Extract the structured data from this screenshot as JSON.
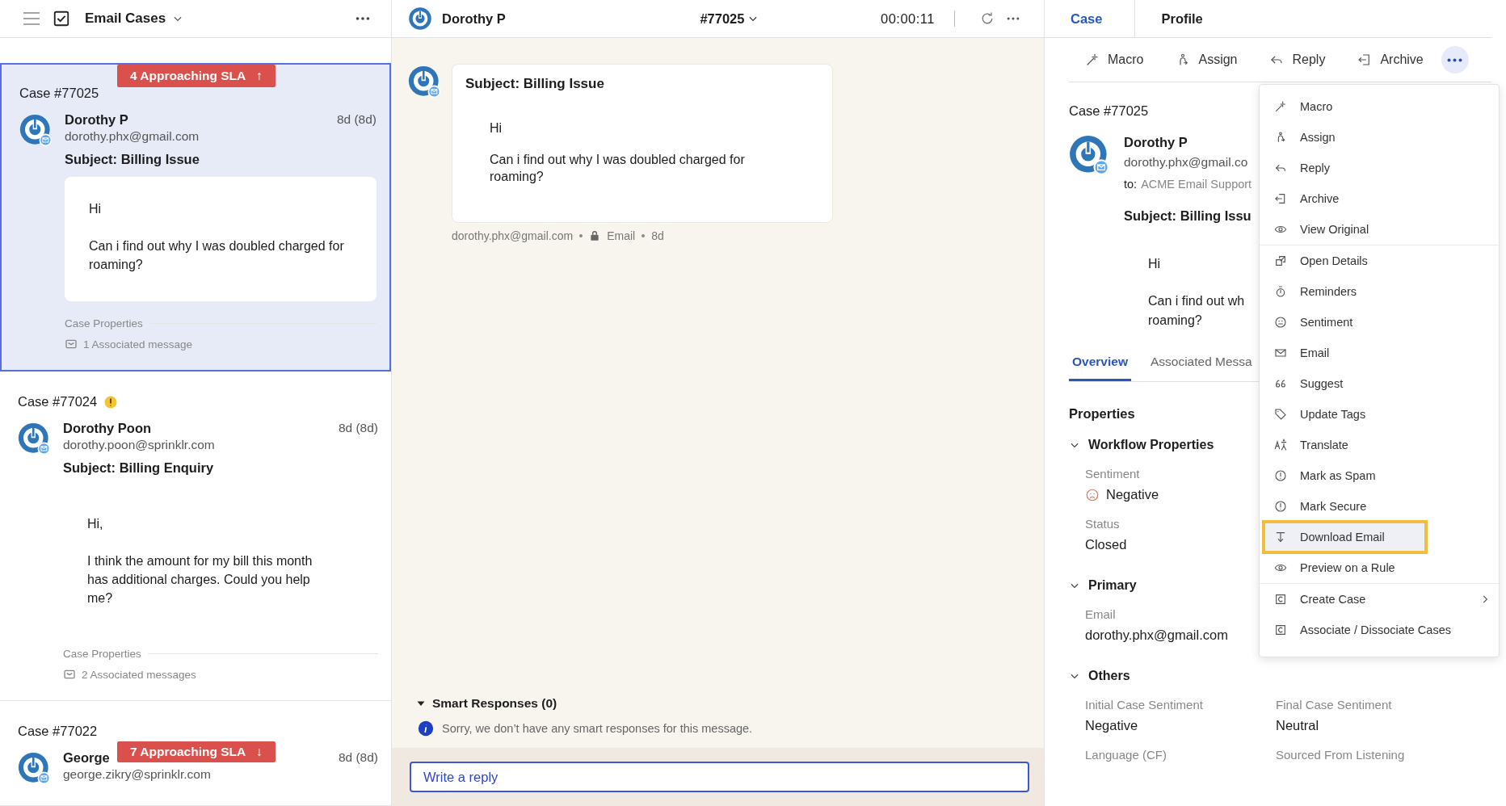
{
  "list_header": {
    "title": "Email Cases",
    "select_all_checked": true
  },
  "cases": [
    {
      "case_number": "Case #77025",
      "warning": false,
      "selected": true,
      "sla": {
        "text": "4 Approaching SLA",
        "arrow": "↑"
      },
      "name": "Dorothy P",
      "email": "dorothy.phx@gmail.com",
      "time": "8d (8d)",
      "subject": "Subject: Billing Issue",
      "boxed": true,
      "body": [
        "Hi",
        "Can i find out why I was doubled charged for roaming?"
      ],
      "properties_label": "Case Properties",
      "associated": "1 Associated message"
    },
    {
      "case_number": "Case #77024",
      "warning": true,
      "selected": false,
      "name": "Dorothy Poon",
      "email": "dorothy.poon@sprinklr.com",
      "time": "8d (8d)",
      "subject": "Subject: Billing Enquiry",
      "boxed": false,
      "body": [
        "Hi,",
        "I think the amount for my bill this month has additional charges. Could you help me?"
      ],
      "properties_label": "Case Properties",
      "associated": "2 Associated messages"
    },
    {
      "case_number": "Case #77022",
      "warning": false,
      "selected": false,
      "sla": {
        "text": "7 Approaching SLA",
        "arrow": "↓"
      },
      "name": "George",
      "email": "george.zikry@sprinklr.com",
      "time": "8d (8d)"
    }
  ],
  "conversation": {
    "name": "Dorothy P",
    "case_id": "#77025",
    "timer": "00:00:11",
    "message": {
      "subject": "Subject: Billing Issue",
      "body": [
        "Hi",
        "Can i find out why I was doubled charged for roaming?"
      ],
      "sender": "dorothy.phx@gmail.com",
      "channel": "Email",
      "age": "8d"
    },
    "smart_responses": {
      "title": "Smart Responses (0)",
      "expanded": true,
      "note": "Sorry, we don’t have any smart responses for this message."
    },
    "reply": {
      "placeholder": "Write a reply"
    }
  },
  "detail": {
    "tabs": [
      {
        "label": "Case",
        "selected": true
      },
      {
        "label": "Profile",
        "selected": false
      }
    ],
    "actions": [
      "Macro",
      "Assign",
      "Reply",
      "Archive"
    ],
    "more_open": true,
    "case_title": "Case #77025",
    "name": "Dorothy P",
    "email": "dorothy.phx@gmail.co",
    "to_label": "to:",
    "to": "ACME Email Support",
    "subject": "Subject: Billing Issu",
    "body": [
      "Hi",
      "Can i find out wh",
      "roaming?"
    ],
    "subtabs": [
      {
        "label": "Overview",
        "selected": true
      },
      {
        "label": "Associated Messa",
        "selected": false
      }
    ],
    "properties": {
      "title": "Properties",
      "sections": [
        {
          "title": "Workflow Properties",
          "expanded": true,
          "rows": [
            [
              {
                "label": "Sentiment",
                "value": "Negative",
                "kind": "sentiment"
              }
            ],
            [
              {
                "label": "Status",
                "value": "Closed",
                "kind": "text"
              }
            ]
          ]
        },
        {
          "title": "Primary",
          "expanded": true,
          "rows": [
            [
              {
                "label": "Email",
                "value": "dorothy.phx@gmail.com",
                "kind": "text"
              }
            ]
          ]
        },
        {
          "title": "Others",
          "expanded": true,
          "rows": [
            [
              {
                "label": "Initial Case Sentiment",
                "value": "Negative",
                "kind": "text"
              },
              {
                "label": "Final Case Sentiment",
                "value": "Neutral",
                "kind": "text"
              }
            ],
            [
              {
                "label": "Language (CF)"
              },
              {
                "label": "Sourced From Listening"
              }
            ]
          ]
        }
      ]
    }
  },
  "menu": {
    "items": [
      {
        "label": "Macro",
        "selected": false
      },
      {
        "label": "Assign",
        "selected": false
      },
      {
        "label": "Reply",
        "selected": false
      },
      {
        "label": "Archive",
        "selected": false
      },
      {
        "label": "View Original",
        "selected": false,
        "divider_after": true
      },
      {
        "label": "Open Details",
        "selected": false
      },
      {
        "label": "Reminders",
        "selected": false
      },
      {
        "label": "Sentiment",
        "selected": false
      },
      {
        "label": "Email",
        "selected": false
      },
      {
        "label": "Suggest",
        "selected": false
      },
      {
        "label": "Update Tags",
        "selected": false
      },
      {
        "label": "Translate",
        "selected": false
      },
      {
        "label": "Mark as Spam",
        "selected": false
      },
      {
        "label": "Mark Secure",
        "selected": false
      },
      {
        "label": "Download Email",
        "selected": true
      },
      {
        "label": "Preview on a Rule",
        "selected": false,
        "divider_after": true
      },
      {
        "label": "Create Case",
        "selected": false,
        "submenu": true
      },
      {
        "label": "Associate / Dissociate Cases",
        "selected": false
      }
    ]
  }
}
